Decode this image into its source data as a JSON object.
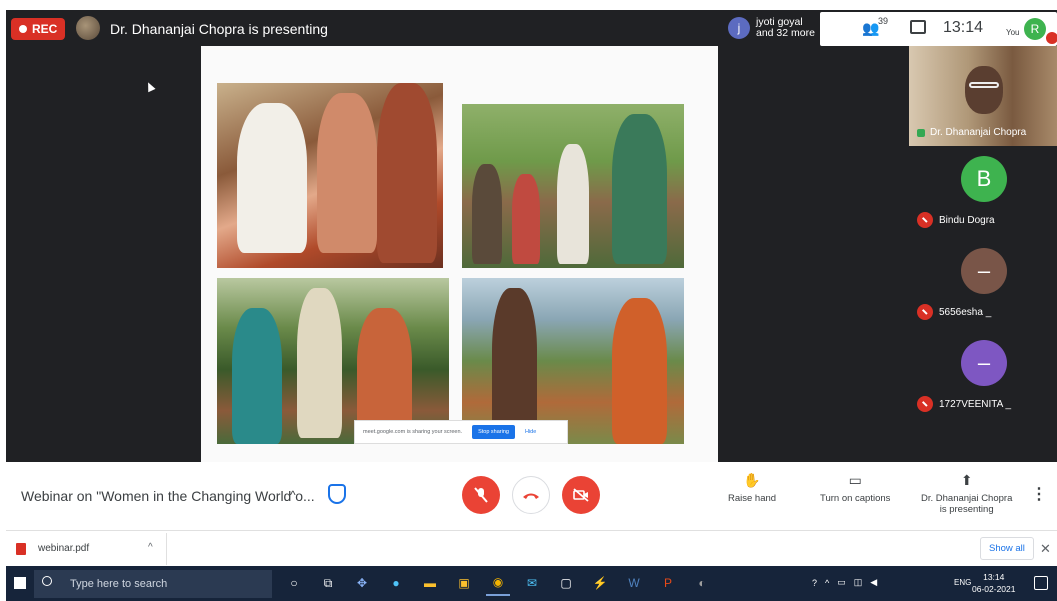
{
  "topbar": {
    "rec_label": "REC",
    "presenting_text": "Dr. Dhananjai Chopra is presenting",
    "attendee_initial": "j",
    "attendee_line1": "jyoti goyal",
    "attendee_line2": "and 32 more",
    "people_count": "39",
    "clock": "13:14",
    "you_label": "You",
    "you_initial": "R"
  },
  "share_bar": {
    "message": "meet.google.com is sharing your screen.",
    "stop_label": "Stop sharing",
    "hide_label": "Hide"
  },
  "tiles": {
    "main_name": "Dr. Dhananjai Chopra",
    "participants": [
      {
        "initial": "B",
        "name": "Bindu Dogra",
        "color": "#3eb34f"
      },
      {
        "initial": "–",
        "name": "5656esha _",
        "color": "#795548"
      },
      {
        "initial": "–",
        "name": "1727VEENITA _",
        "color": "#7e57c2"
      }
    ]
  },
  "controls": {
    "meeting_title": "Webinar on \"Women in the Changing World o...",
    "raise_hand": "Raise hand",
    "captions": "Turn on captions",
    "presenting_line1": "Dr. Dhananjai Chopra",
    "presenting_line2": "is presenting"
  },
  "downloads": {
    "file_name": "webinar.pdf",
    "show_all": "Show all"
  },
  "taskbar": {
    "search_placeholder": "Type here to search",
    "lang": "ENG",
    "time": "13:14",
    "date": "06-02-2021"
  },
  "colors": {
    "rec": "#d93025",
    "accent": "#1a73e8",
    "end_call": "#ea4335"
  }
}
